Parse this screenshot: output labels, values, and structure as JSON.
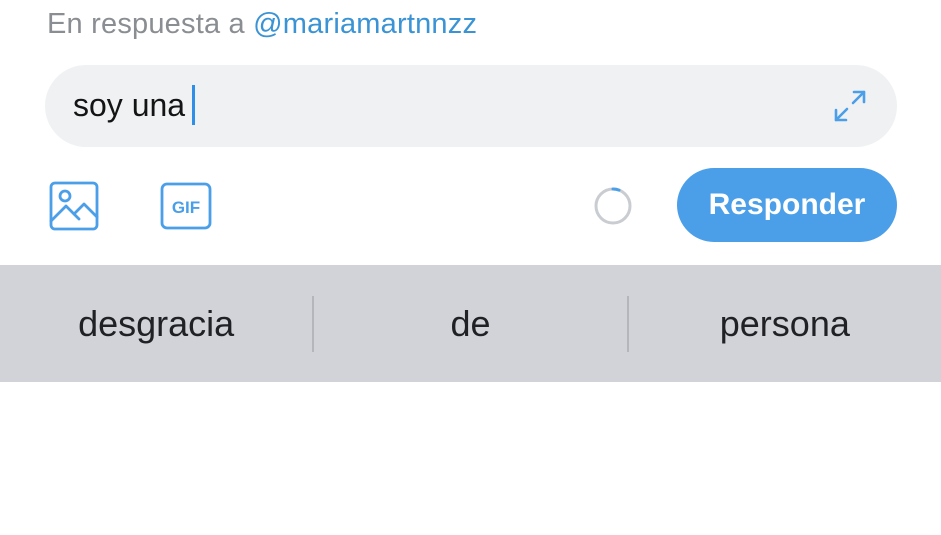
{
  "reply_header": {
    "prefix": "En respuesta a ",
    "handle": "@mariamartnnzz"
  },
  "composer": {
    "text": "soy una",
    "expand_icon": "expand-arrows-icon"
  },
  "toolbar": {
    "image_icon": "image-icon",
    "gif_label": "GIF",
    "progress_icon": "character-count-ring",
    "reply_label": "Responder"
  },
  "suggestions": [
    {
      "label": "desgracia"
    },
    {
      "label": "de"
    },
    {
      "label": "persona"
    }
  ],
  "colors": {
    "accent": "#4a9fe8",
    "handle": "#3a93d4",
    "muted_text": "#8a8d91",
    "input_bg": "#eff1f3",
    "suggestion_bg": "#d1d3d9"
  }
}
